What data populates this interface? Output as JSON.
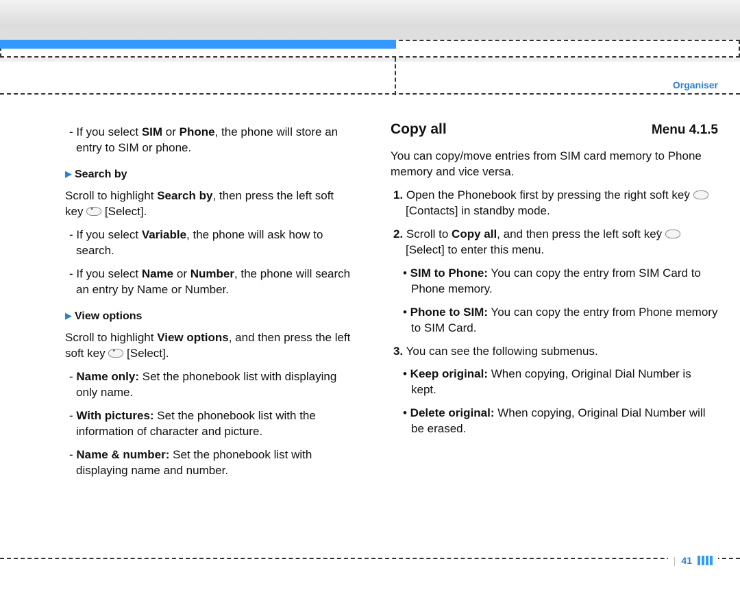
{
  "header": {
    "section_label": "Organiser"
  },
  "left": {
    "p1_pre": "- If you select ",
    "p1_b1": "SIM",
    "p1_mid": " or ",
    "p1_b2": "Phone",
    "p1_post": ", the phone will store an entry to SIM or phone.",
    "sub1": "Search by",
    "p2_pre": "Scroll to highlight ",
    "p2_b": "Search by",
    "p2_post_a": ", then press the left soft key ",
    "p2_post_b": " [Select].",
    "p3_pre": "- If you select ",
    "p3_b": "Variable",
    "p3_post": ", the phone will ask how to search.",
    "p4_pre": "- If you select ",
    "p4_b1": "Name",
    "p4_mid": " or ",
    "p4_b2": "Number",
    "p4_post": ", the phone will search an entry by Name or Number.",
    "sub2": "View options",
    "p5_pre": "Scroll to highlight ",
    "p5_b": "View options",
    "p5_post_a": ", and then press the left soft key ",
    "p5_post_b": " [Select].",
    "p6_pre": "- ",
    "p6_b": "Name only:",
    "p6_post": " Set the phonebook list with displaying only name.",
    "p7_pre": "- ",
    "p7_b": "With pictures:",
    "p7_post": " Set the phonebook list with the information of character and picture.",
    "p8_pre": "- ",
    "p8_b": "Name & number:",
    "p8_post": " Set the phonebook list with displaying name and number."
  },
  "right": {
    "title": "Copy all",
    "menu": "Menu 4.1.5",
    "intro": "You can copy/move entries from SIM card memory to Phone memory and vice versa.",
    "n1_num": "1.",
    "n1_a": " Open the Phonebook first by pressing the right soft key ",
    "n1_b": " [Contacts] in standby mode.",
    "n2_num": "2.",
    "n2_a": " Scroll to ",
    "n2_b_bold": "Copy all",
    "n2_c": ", and then press the left soft key ",
    "n2_d": " [Select] to enter this menu.",
    "b1_bullet": "•",
    "b1_bold": " SIM to Phone:",
    "b1_text": " You can copy the entry from SIM Card to Phone memory.",
    "b2_bullet": "•",
    "b2_bold": " Phone to SIM:",
    "b2_text": " You can copy the entry from Phone memory to SIM Card.",
    "n3_num": "3.",
    "n3_text": " You can see the following submenus.",
    "b3_bullet": "•",
    "b3_bold": " Keep original:",
    "b3_text": " When copying, Original Dial Number is kept.",
    "b4_bullet": "•",
    "b4_bold": " Delete original:",
    "b4_text": " When copying, Original Dial Number will be erased."
  },
  "footer": {
    "page": "41"
  }
}
